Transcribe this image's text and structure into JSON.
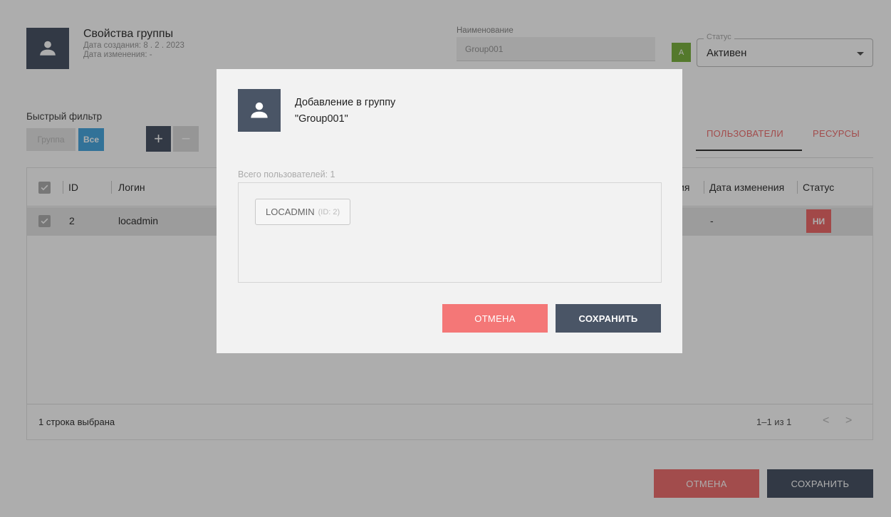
{
  "header": {
    "title": "Свойства группы",
    "created": "Дата создания: 8 . 2 . 2023",
    "modified": "Дата изменения: -",
    "name_label": "Наименование",
    "name_value": "Group001",
    "status_letter": "A",
    "status_label": "Статус",
    "status_value": "Активен"
  },
  "filter": {
    "label": "Быстрый фильтр",
    "chip_group": "Группа",
    "chip_all": "Все",
    "add_symbol": "+",
    "remove_symbol": "−"
  },
  "tabs": [
    {
      "label": "ПОЛЬЗОВАТЕЛИ",
      "active": true
    },
    {
      "label": "РЕСУРСЫ",
      "active": false
    }
  ],
  "table": {
    "columns": [
      "ID",
      "Логин",
      "ия",
      "Дата изменения",
      "Статус"
    ],
    "rows": [
      {
        "id": "2",
        "login": "locadmin",
        "modified": "-",
        "status": "НИ"
      }
    ],
    "footer_selected": "1 строка выбрана",
    "footer_range": "1–1 из 1",
    "prev_symbol": "<",
    "next_symbol": ">"
  },
  "actions": {
    "cancel": "ОТМЕНА",
    "save": "СОХРАНИТЬ"
  },
  "modal": {
    "title": "Добавление в группу",
    "subtitle": "\"Group001\"",
    "count": "Всего пользователей: 1",
    "chip_name": "LOCADMIN",
    "chip_id": "(ID: 2)",
    "cancel": "ОТМЕНА",
    "save": "СОХРАНИТЬ"
  },
  "colors": {
    "accent_dark": "#4a5566",
    "accent_red": "#ef7070",
    "accent_blue": "#4aa9e0",
    "status_green": "#7cb342"
  }
}
